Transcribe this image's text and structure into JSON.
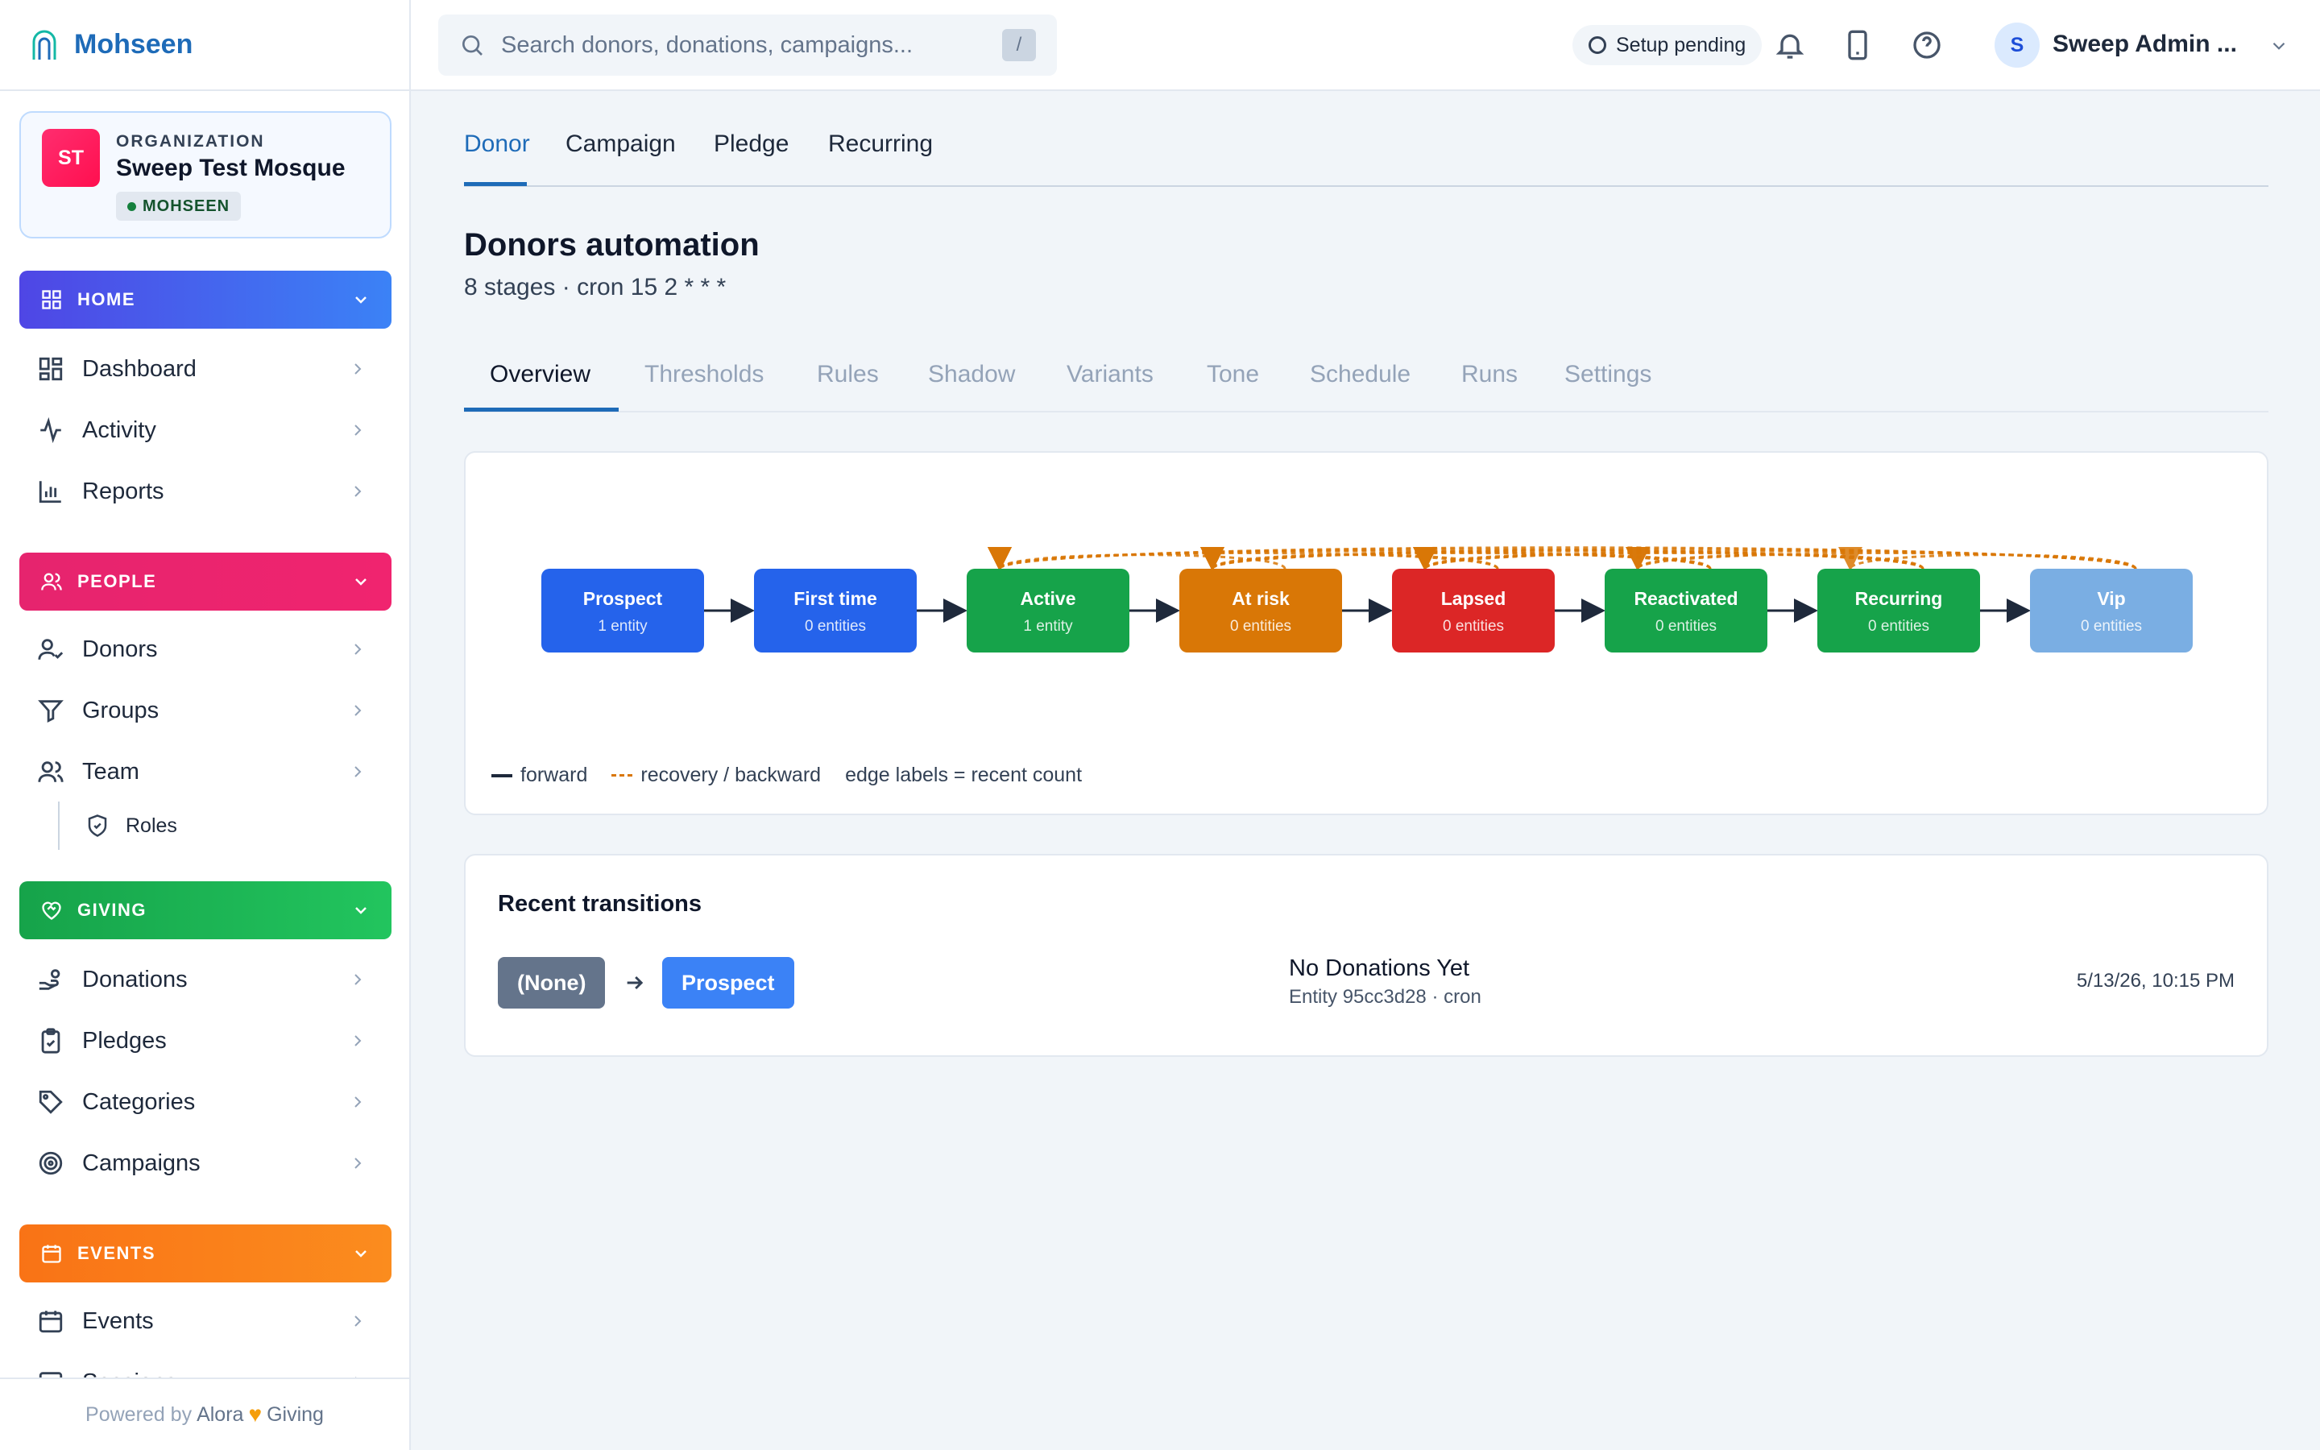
{
  "brand": {
    "name": "Mohseen"
  },
  "org": {
    "label": "ORGANIZATION",
    "initials": "ST",
    "name": "Sweep Test Mosque",
    "badge": "MOHSEEN"
  },
  "sidebar": {
    "sections": [
      {
        "label": "HOME",
        "items": [
          "Dashboard",
          "Activity",
          "Reports"
        ]
      },
      {
        "label": "PEOPLE",
        "items": [
          "Donors",
          "Groups",
          "Team"
        ],
        "sub_items": [
          "Roles"
        ]
      },
      {
        "label": "GIVING",
        "items": [
          "Donations",
          "Pledges",
          "Categories",
          "Campaigns"
        ]
      },
      {
        "label": "EVENTS",
        "items": [
          "Events",
          "Sessions"
        ]
      }
    ],
    "footer": {
      "prefix": "Powered by",
      "brand_a": "Alora",
      "brand_b": "Giving"
    }
  },
  "topbar": {
    "search_placeholder": "Search donors, donations, campaigns...",
    "search_shortcut": "/",
    "setup_status": "Setup pending",
    "user_initial": "S",
    "user_name": "Sweep Admin ..."
  },
  "entity_tabs": [
    "Donor",
    "Campaign",
    "Pledge",
    "Recurring"
  ],
  "entity_tab_active": "Donor",
  "page": {
    "title": "Donors automation",
    "subtitle": "8 stages · cron 15 2 * * *"
  },
  "detail_tabs": [
    "Overview",
    "Thresholds",
    "Rules",
    "Shadow",
    "Variants",
    "Tone",
    "Schedule",
    "Runs",
    "Settings"
  ],
  "detail_tab_active": "Overview",
  "flow": {
    "stages": [
      {
        "name": "Prospect",
        "count": "1 entity",
        "color": "#2563eb"
      },
      {
        "name": "First time",
        "count": "0 entities",
        "color": "#2563eb"
      },
      {
        "name": "Active",
        "count": "1 entity",
        "color": "#16a34a"
      },
      {
        "name": "At risk",
        "count": "0 entities",
        "color": "#d97706"
      },
      {
        "name": "Lapsed",
        "count": "0 entities",
        "color": "#dc2626"
      },
      {
        "name": "Reactivated",
        "count": "0 entities",
        "color": "#16a34a"
      },
      {
        "name": "Recurring",
        "count": "0 entities",
        "color": "#16a34a"
      },
      {
        "name": "Vip",
        "count": "0 entities",
        "color": "#7aaee3"
      }
    ],
    "legend": {
      "forward": "forward",
      "backward": "recovery / backward",
      "note": "edge labels = recent count"
    },
    "colors": {
      "forward": "#1e293b",
      "backward": "#d97706"
    }
  },
  "transitions": {
    "title": "Recent transitions",
    "items": [
      {
        "from": "(None)",
        "to": "Prospect",
        "reason": "No Donations Yet",
        "entity": "Entity 95cc3d28 · cron",
        "time": "5/13/26, 10:15 PM"
      }
    ]
  }
}
